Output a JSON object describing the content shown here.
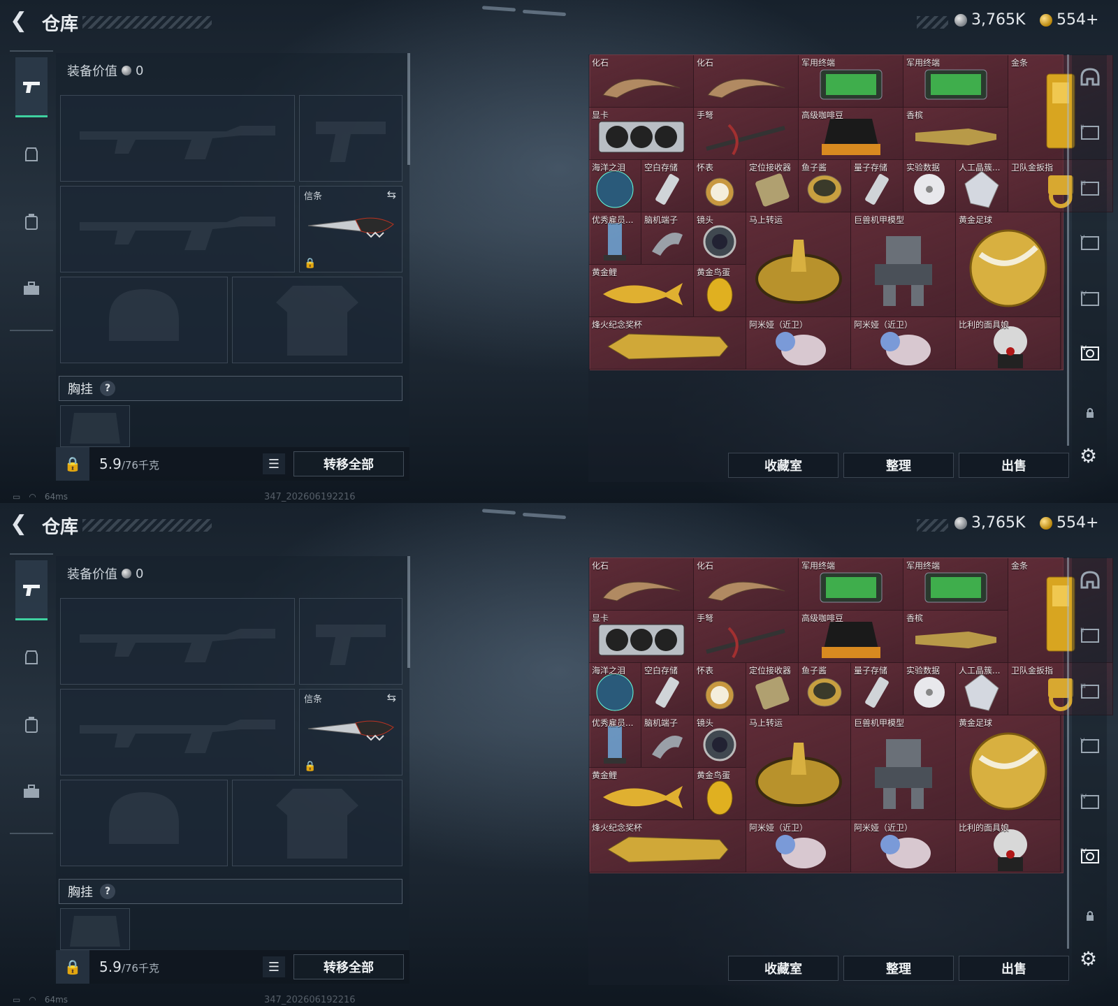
{
  "header": {
    "title": "仓库",
    "silver": "3,765K",
    "gold": "554+"
  },
  "left_rail": {
    "items": [
      {
        "icon": "pistol-icon",
        "active": true
      },
      {
        "icon": "armor-icon",
        "active": false
      },
      {
        "icon": "backpack-icon",
        "active": false
      },
      {
        "icon": "toolbox-icon",
        "active": false
      }
    ]
  },
  "loadout": {
    "equip_value_label": "装备价值",
    "equip_value": "0",
    "melee_label": "信条",
    "chest_label": "胸挂",
    "help": "?",
    "weight_value": "5.9",
    "weight_max": "/76千克",
    "transfer_all": "转移全部"
  },
  "status": {
    "ping": "64ms",
    "build": "347_202606192216"
  },
  "inventory": {
    "items": [
      {
        "label": "化石",
        "icon": "fossil-claw-icon",
        "color": "#b18a62"
      },
      {
        "label": "化石",
        "icon": "fossil-claw-icon",
        "color": "#b18a62"
      },
      {
        "label": "军用终端",
        "icon": "military-terminal-icon",
        "color": "#3fae4c"
      },
      {
        "label": "军用终端",
        "icon": "military-terminal-icon",
        "color": "#3fae4c"
      },
      {
        "label": "金条",
        "icon": "gold-bar-icon",
        "color": "#d8a520"
      },
      {
        "label": "显卡",
        "icon": "graphics-card-icon",
        "color": "#b9bec4"
      },
      {
        "label": "手弩",
        "icon": "hand-crossbow-icon",
        "color": "#a23030"
      },
      {
        "label": "高级咖啡豆",
        "icon": "coffee-bag-icon",
        "color": "#d88a20"
      },
      {
        "label": "香槟",
        "icon": "champagne-icon",
        "color": "#b89a48"
      },
      {
        "label": "海洋之泪",
        "icon": "pearl-icon",
        "color": "#2a5a7a"
      },
      {
        "label": "空白存储",
        "icon": "usb-drive-icon",
        "color": "#d0d4d8"
      },
      {
        "label": "怀表",
        "icon": "pocket-watch-icon",
        "color": "#c89840"
      },
      {
        "label": "定位接收器",
        "icon": "receiver-icon",
        "color": "#b0a070"
      },
      {
        "label": "鱼子酱",
        "icon": "caviar-tin-icon",
        "color": "#c8a040"
      },
      {
        "label": "量子存储",
        "icon": "usb-drive-icon",
        "color": "#d0d4d8"
      },
      {
        "label": "实验数据",
        "icon": "disc-icon",
        "color": "#e8e8ec"
      },
      {
        "label": "人工晶簇...",
        "icon": "crystal-icon",
        "color": "#d4d8e0"
      },
      {
        "label": "卫队金扳指",
        "icon": "gold-ring-icon",
        "color": "#d8a830"
      },
      {
        "label": "优秀雇员...",
        "icon": "trophy-crystal-icon",
        "color": "#6fa8d8"
      },
      {
        "label": "脑机端子",
        "icon": "neural-port-icon",
        "color": "#9aa0a8"
      },
      {
        "label": "镜头",
        "icon": "camera-lens-icon",
        "color": "#404850"
      },
      {
        "label": "马上转运",
        "icon": "horse-statue-icon",
        "color": "#b8922c"
      },
      {
        "label": "巨兽机甲模型",
        "icon": "mech-model-icon",
        "color": "#6a7078"
      },
      {
        "label": "黄金足球",
        "icon": "gold-ball-icon",
        "color": "#d8b040"
      },
      {
        "label": "黄金鲤",
        "icon": "gold-carp-icon",
        "color": "#e0b030"
      },
      {
        "label": "黄金鸟蛋",
        "icon": "gold-egg-icon",
        "color": "#e0b020"
      },
      {
        "label": "烽火纪念奖杯",
        "icon": "gold-trophy-icon",
        "color": "#d0a838"
      },
      {
        "label": "阿米娅（近卫）",
        "icon": "figurine-icon",
        "color": "#7a9ad8"
      },
      {
        "label": "阿米娅（近卫）",
        "icon": "figurine-icon",
        "color": "#7a9ad8"
      },
      {
        "label": "比利的面具娘",
        "icon": "puppet-icon",
        "color": "#d8d8d8"
      }
    ],
    "buttons": {
      "collection": "收藏室",
      "sort": "整理",
      "sell": "出售"
    }
  },
  "right_tabs": {
    "items": [
      {
        "icon": "helmet-icon",
        "active": false
      },
      {
        "icon": "tab-ii-icon",
        "active": false
      },
      {
        "icon": "tab-iii-icon",
        "active": false
      },
      {
        "icon": "tab-iv-icon",
        "active": false
      },
      {
        "icon": "tab-v-icon",
        "active": false
      },
      {
        "icon": "tab-vi-icon",
        "active": true
      },
      {
        "icon": "lock-icon",
        "active": false
      }
    ]
  }
}
